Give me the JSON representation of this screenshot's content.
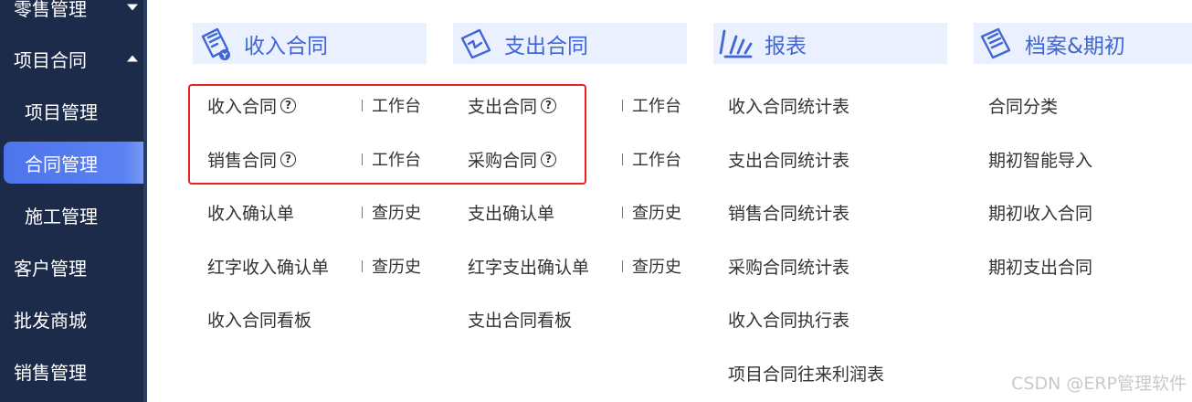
{
  "sidebar": {
    "items": [
      {
        "label": "零售管理",
        "caret": "down"
      },
      {
        "label": "项目合同",
        "caret": "up"
      },
      {
        "label": "项目管理"
      },
      {
        "label": "合同管理"
      },
      {
        "label": "施工管理"
      },
      {
        "label": "客户管理"
      },
      {
        "label": "批发商城"
      },
      {
        "label": "销售管理"
      }
    ],
    "active_index": 3
  },
  "categories": [
    {
      "title": "收入合同",
      "icon": "income-contract-icon",
      "items": [
        {
          "label": "收入合同",
          "help": true,
          "link": "工作台"
        },
        {
          "label": "销售合同",
          "help": true,
          "link": "工作台"
        },
        {
          "label": "收入确认单",
          "link": "查历史"
        },
        {
          "label": "红字收入确认单",
          "link": "查历史"
        },
        {
          "label": "收入合同看板"
        }
      ]
    },
    {
      "title": "支出合同",
      "icon": "expense-contract-icon",
      "items": [
        {
          "label": "支出合同",
          "help": true,
          "link": "工作台"
        },
        {
          "label": "采购合同",
          "help": true,
          "link": "工作台"
        },
        {
          "label": "支出确认单",
          "link": "查历史"
        },
        {
          "label": "红字支出确认单",
          "link": "查历史"
        },
        {
          "label": "支出合同看板"
        }
      ]
    },
    {
      "title": "报表",
      "icon": "report-icon",
      "items": [
        {
          "label": "收入合同统计表"
        },
        {
          "label": "支出合同统计表"
        },
        {
          "label": "销售合同统计表"
        },
        {
          "label": "采购合同统计表"
        },
        {
          "label": "收入合同执行表"
        },
        {
          "label": "项目合同往来利润表"
        }
      ]
    },
    {
      "title": "档案&期初",
      "icon": "archive-icon",
      "items": [
        {
          "label": "合同分类"
        },
        {
          "label": "期初智能导入"
        },
        {
          "label": "期初收入合同"
        },
        {
          "label": "期初支出合同"
        }
      ]
    }
  ],
  "colors": {
    "sidebar_bg": "#1d2b4a",
    "active_item": "#5b82f2",
    "header_bg": "#eaf0fd",
    "header_text": "#4066d6",
    "highlight_border": "#e8231e"
  },
  "watermark": "CSDN @ERP管理软件"
}
